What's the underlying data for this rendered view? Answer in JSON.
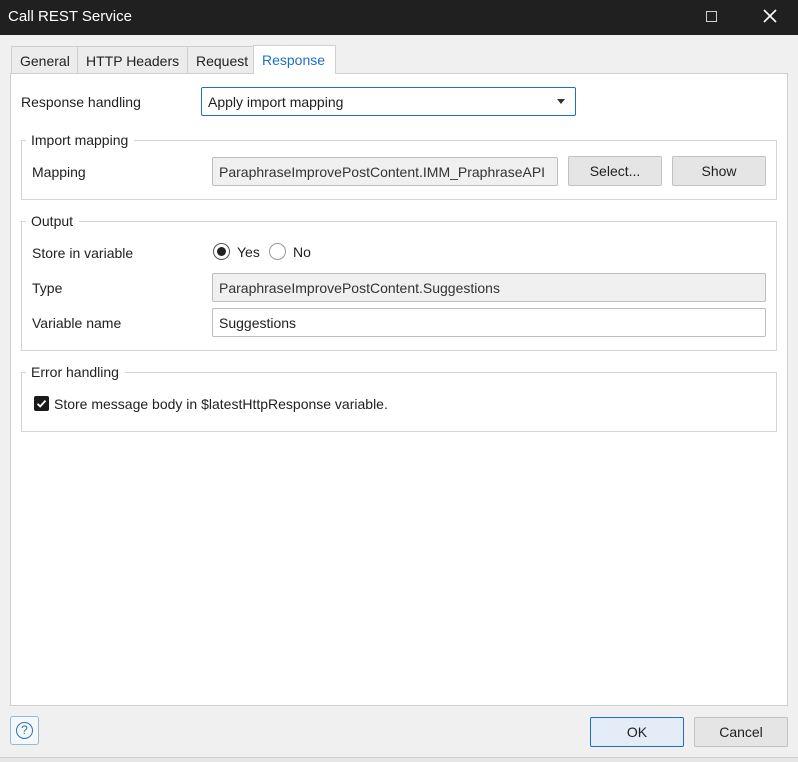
{
  "window": {
    "title": "Call REST Service",
    "maximize_icon": "maximize-icon",
    "close_icon": "close-icon"
  },
  "tabs": [
    {
      "label": "General",
      "active": false
    },
    {
      "label": "HTTP Headers",
      "active": false
    },
    {
      "label": "Request",
      "active": false
    },
    {
      "label": "Response",
      "active": true
    }
  ],
  "response_handling": {
    "label": "Response handling",
    "value": "Apply import mapping"
  },
  "import_mapping": {
    "legend": "Import mapping",
    "mapping_label": "Mapping",
    "mapping_value": "ParaphraseImprovePostContent.IMM_PraphraseAPI",
    "select_label": "Select...",
    "show_label": "Show"
  },
  "output": {
    "legend": "Output",
    "store_label": "Store in variable",
    "yes_label": "Yes",
    "no_label": "No",
    "selected": "Yes",
    "type_label": "Type",
    "type_value": "ParaphraseImprovePostContent.Suggestions",
    "varname_label": "Variable name",
    "varname_value": "Suggestions"
  },
  "error_handling": {
    "legend": "Error handling",
    "checkbox_label": "Store message body in $latestHttpResponse variable.",
    "checked": true
  },
  "footer": {
    "help_icon": "help-icon",
    "ok_label": "OK",
    "cancel_label": "Cancel"
  },
  "colors": {
    "accent": "#1f6fc4",
    "titlebar": "#202020"
  }
}
